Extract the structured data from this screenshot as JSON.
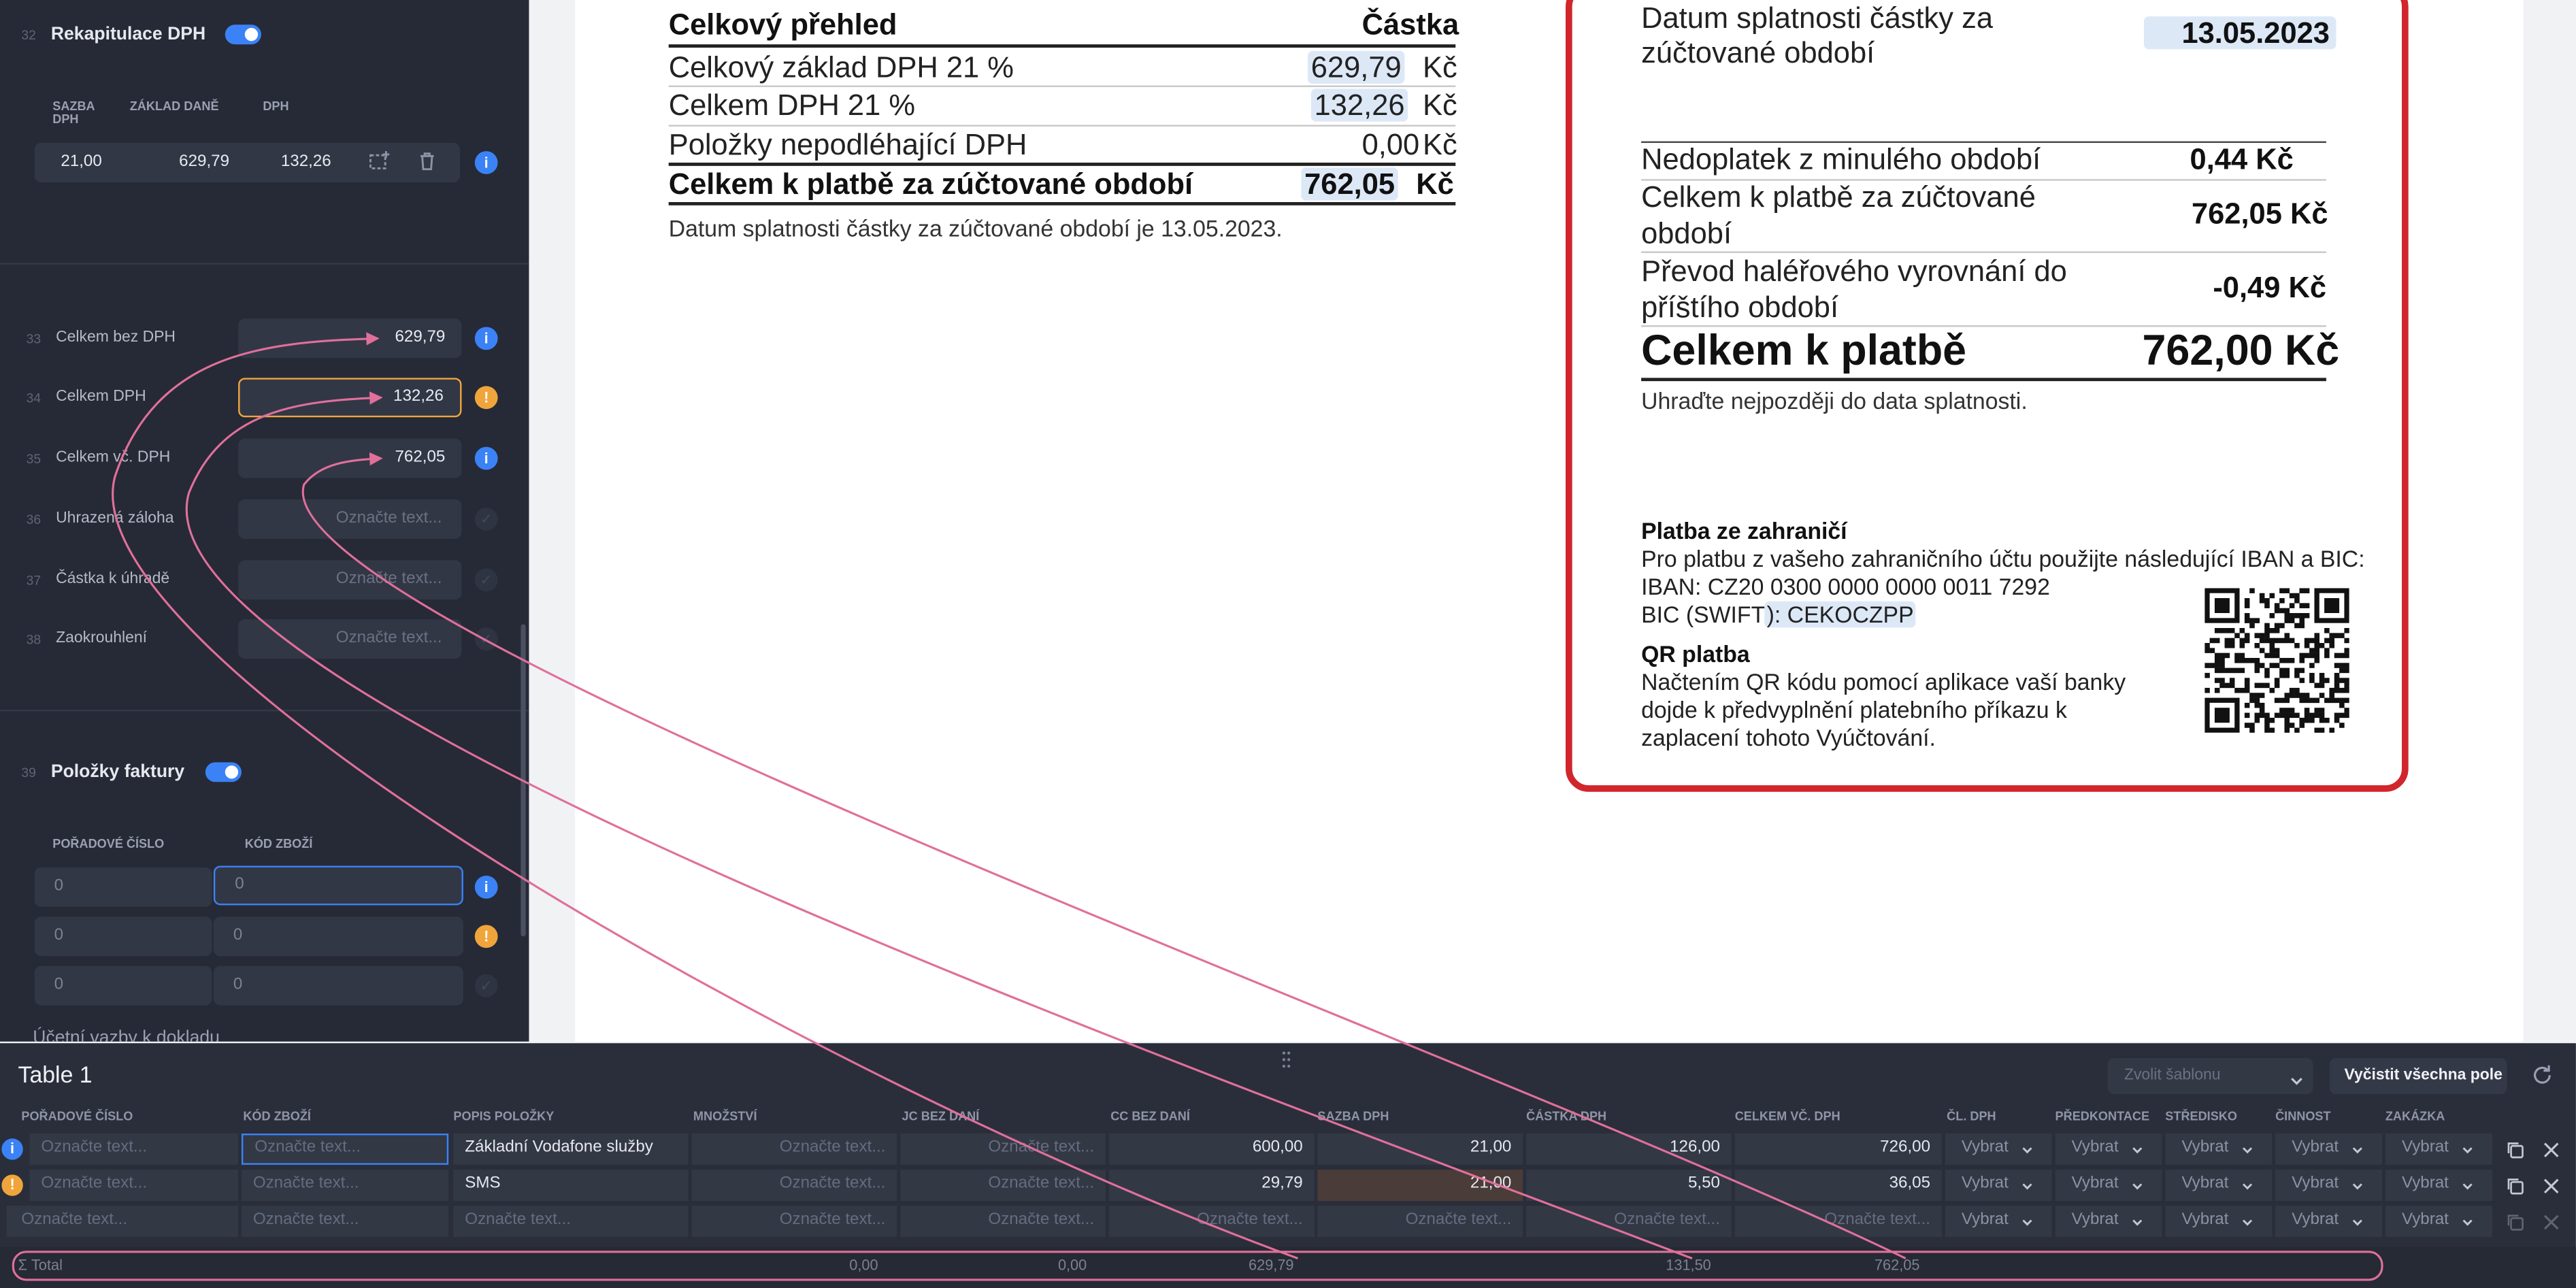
{
  "sidebar": {
    "rekap": {
      "num": "32",
      "title": "Rekapitulace DPH",
      "col_sazba": "SAZBA DPH",
      "col_zaklad": "ZÁKLAD DANĚ",
      "col_dph": "DPH",
      "sazba": "21,00",
      "zaklad": "629,79",
      "dph": "132,26"
    },
    "fields": [
      {
        "num": "33",
        "label": "Celkem bez DPH",
        "value": "629,79",
        "status": "info"
      },
      {
        "num": "34",
        "label": "Celkem DPH",
        "value": "132,26",
        "status": "warning"
      },
      {
        "num": "35",
        "label": "Celkem vč. DPH",
        "value": "762,05",
        "status": "info"
      },
      {
        "num": "36",
        "label": "Uhrazená záloha",
        "placeholder": "Označte text...",
        "status": "none"
      },
      {
        "num": "37",
        "label": "Částka k úhradě",
        "placeholder": "Označte text...",
        "status": "none"
      },
      {
        "num": "38",
        "label": "Zaokrouhlení",
        "placeholder": "Označte text...",
        "status": "none"
      }
    ],
    "polozky": {
      "num": "39",
      "title": "Položky faktury",
      "col_poradove": "POŘADOVÉ ČÍSLO",
      "col_kod": "KÓD ZBOŽÍ",
      "rows": [
        {
          "poradove": "0",
          "kod": "0"
        },
        {
          "poradove": "0",
          "kod": "0"
        },
        {
          "poradove": "0",
          "kod": "0"
        }
      ]
    },
    "next_section": "Účetní vazby k dokladu"
  },
  "document": {
    "left": {
      "header_label": "Celkový přehled",
      "header_amount": "Částka",
      "rows": [
        {
          "label": "Celkový základ DPH 21 %",
          "amount": "629,79",
          "unit": "Kč"
        },
        {
          "label": "Celkem DPH 21 %",
          "amount": "132,26",
          "unit": "Kč"
        },
        {
          "label": "Položky nepodléhající DPH",
          "amount": "0,00",
          "unit": "Kč"
        }
      ],
      "total_label": "Celkem k platbě za zúčtované období",
      "total_amount": "762,05",
      "total_unit": "Kč",
      "due_note": "Datum splatnosti částky za zúčtované období je 13.05.2023."
    },
    "right": {
      "due_label_1": "Datum splatnosti částky za",
      "due_label_2": "zúčtované období",
      "due_value": "13.05.2023",
      "nedoplatek_label": "Nedoplatek z minulého období",
      "nedoplatek_value": "0,44 Kč",
      "celkem_label_1": "Celkem k platbě za zúčtované",
      "celkem_label_2": "období",
      "celkem_value": "762,05 Kč",
      "prevod_label_1": "Převod haléřového vyrovnání do",
      "prevod_label_2": "příštího období",
      "prevod_value": "-0,49 Kč",
      "total_label": "Celkem k platbě",
      "total_value": "762,00 Kč",
      "pay_note": "Uhraďte nejpozději do data splatnosti.",
      "foreign_title": "Platba ze zahraničí",
      "foreign_line1": "Pro platbu z vašeho zahraničního účtu použijte následující IBAN a BIC:",
      "iban": "IBAN: CZ20 0300 0000 0000 0011 7292",
      "bic_prefix": "BIC (SWIFT",
      "bic_value": "): CEKOCZPP",
      "qr_title": "QR platba",
      "qr_line1": "Načtením QR kódu pomocí aplikace vaší banky",
      "qr_line2": "dojde k předvyplnění platebního příkazu k",
      "qr_line3": "zaplacení tohoto Vyúčtování."
    }
  },
  "table": {
    "title": "Table 1",
    "template_placeholder": "Zvolit šablonu",
    "clear_button": "Vyčistit všechna pole",
    "columns": [
      "POŘADOVÉ ČÍSLO",
      "KÓD ZBOŽÍ",
      "POPIS POLOŽKY",
      "MNOŽSTVÍ",
      "JC BEZ DANÍ",
      "CC BEZ DANÍ",
      "SAZBA DPH",
      "ČÁSTKA DPH",
      "CELKEM VČ. DPH",
      "ČL. DPH",
      "PŘEDKONTACE",
      "STŘEDISKO",
      "ČINNOST",
      "ZAKÁZKA"
    ],
    "placeholder": "Označte text...",
    "select_label": "Vybrat",
    "rows": [
      {
        "status": "info",
        "popis": "Základní Vodafone služby",
        "cc": "600,00",
        "sazba": "21,00",
        "castka": "126,00",
        "celkem": "726,00"
      },
      {
        "status": "warning",
        "popis": "SMS",
        "cc": "29,79",
        "sazba": "21,00",
        "castka": "5,50",
        "celkem": "36,05"
      }
    ],
    "total": {
      "label": "Σ Total",
      "jc": "0,00",
      "cc_first": "0,00",
      "cc": "629,79",
      "castka": "131,50",
      "celkem": "762,05"
    }
  },
  "colors": {
    "accent": "#3b82f6",
    "warning": "#f0a53c",
    "arrow": "#e0709a",
    "frame": "#d0262c",
    "highlight": "#dde8f7"
  }
}
